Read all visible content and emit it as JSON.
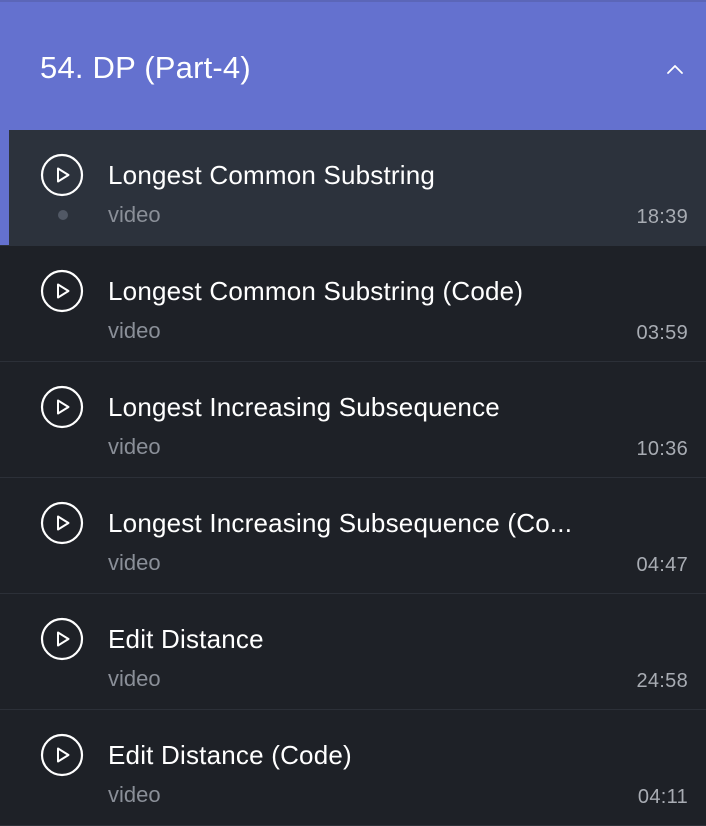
{
  "section": {
    "title": "54. DP (Part-4)",
    "icon": "chevron-up-icon",
    "expanded": true,
    "accent_color": "#6471cf"
  },
  "lessons": [
    {
      "title": "Longest Common Substring",
      "type": "video",
      "duration": "18:39",
      "active": true,
      "icon": "play-circle-icon"
    },
    {
      "title": "Longest Common Substring (Code)",
      "type": "video",
      "duration": "03:59",
      "active": false,
      "icon": "play-circle-icon"
    },
    {
      "title": "Longest Increasing Subsequence",
      "type": "video",
      "duration": "10:36",
      "active": false,
      "icon": "play-circle-icon"
    },
    {
      "title": "Longest Increasing Subsequence (Co...",
      "type": "video",
      "duration": "04:47",
      "active": false,
      "icon": "play-circle-icon"
    },
    {
      "title": "Edit Distance",
      "type": "video",
      "duration": "24:58",
      "active": false,
      "icon": "play-circle-icon"
    },
    {
      "title": "Edit Distance (Code)",
      "type": "video",
      "duration": "04:11",
      "active": false,
      "icon": "play-circle-icon"
    }
  ]
}
